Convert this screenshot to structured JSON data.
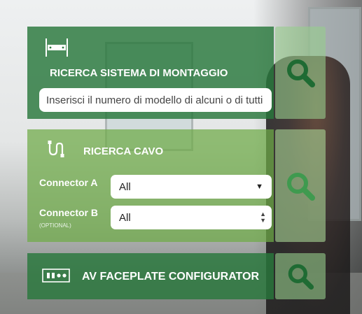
{
  "mount_search": {
    "title": "RICERCA SISTEMA DI MONTAGGIO",
    "input_placeholder": "Inserisci il numero di modello di alcuni o di tutti",
    "icon": "rack-mount-icon"
  },
  "cable_search": {
    "title": "RICERCA CAVO",
    "icon": "cable-icon",
    "connector_a_label": "Connector A",
    "connector_a_value": "All",
    "connector_b_label": "Connector B",
    "connector_b_optional": "(OPTIONAL)",
    "connector_b_value": "All"
  },
  "faceplate": {
    "title": "AV FACEPLATE CONFIGURATOR",
    "icon": "faceplate-icon"
  },
  "colors": {
    "panel_green": "#2f7c40",
    "button_green": "#9fd08f",
    "search_icon": "#1f6b33"
  }
}
